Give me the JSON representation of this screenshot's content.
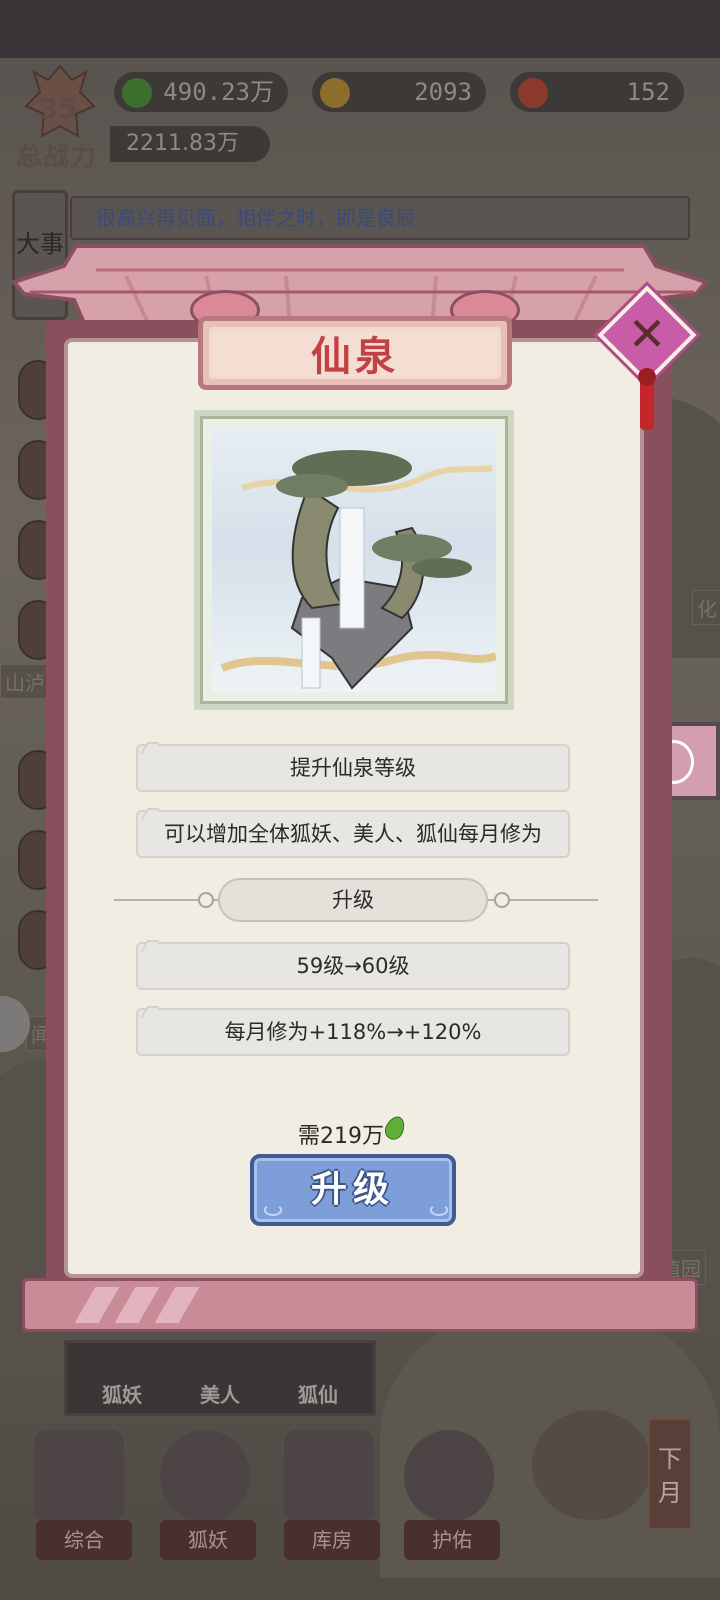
{
  "hud": {
    "level": "35",
    "power_label": "总战力",
    "power_value": "2211.83万",
    "jade": "490.23万",
    "gold": "2093",
    "fruit": "152"
  },
  "notice": {
    "side_tab": "大事",
    "text": "很高兴再见面，相伴之时，即是良辰"
  },
  "background_labels": {
    "left_partial": "山泸",
    "left_partial2": "闻",
    "right_partial": "化",
    "right_garden": "植园"
  },
  "modal": {
    "title": "仙泉",
    "close_icon": "close-icon",
    "desc1": "提升仙泉等级",
    "desc2": "可以增加全体狐妖、美人、狐仙每月修为",
    "section_title": "升级",
    "level_change": "59级→60级",
    "bonus_change": "每月修为+118%→+120%",
    "cost_label": "需219万",
    "upgrade_button": "升级"
  },
  "bottom_tabs": [
    "狐妖",
    "美人",
    "狐仙"
  ],
  "nav": [
    "综合",
    "狐妖",
    "库房",
    "护佑"
  ],
  "next_month": "下月",
  "colors": {
    "title_red": "#c14244",
    "panel_bg": "#f1ede3",
    "button_blue": "#7e9ed9",
    "frame_pink": "#c98b98"
  }
}
